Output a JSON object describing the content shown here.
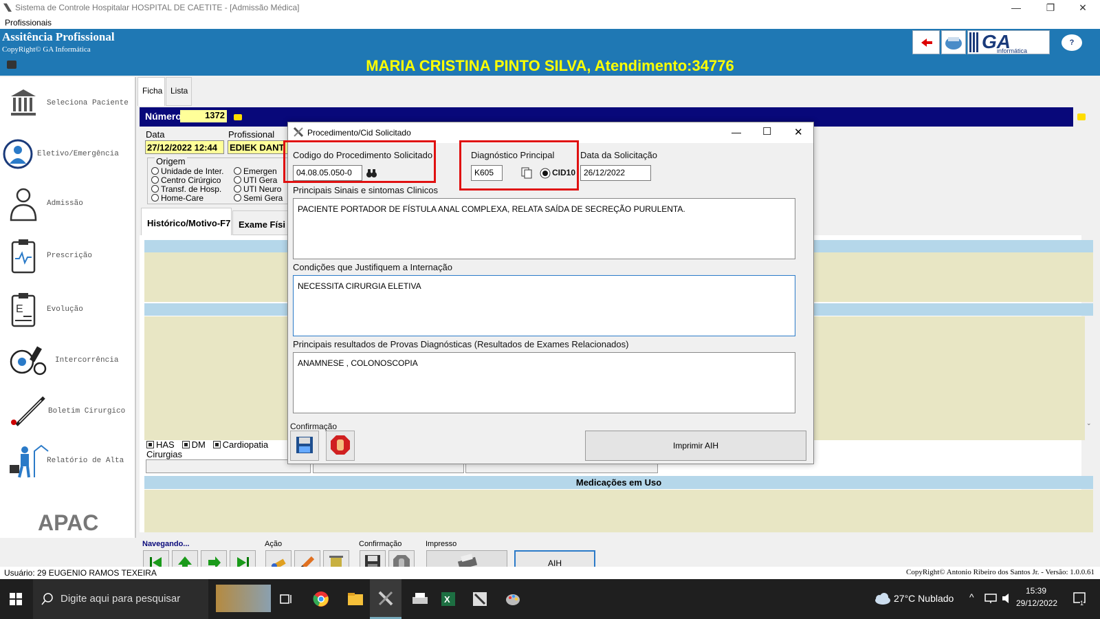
{
  "window": {
    "title": "Sistema de Controle Hospitalar HOSPITAL DE CAETITE - [Admissão Médica]",
    "menu": "Profissionais",
    "minimize": "—",
    "restore": "❐",
    "close": "✕"
  },
  "header": {
    "app_name": "Assitência Profissional",
    "copyright": "CopyRight© GA Informática",
    "logo_text": "GA",
    "logo_sub": "informática",
    "help": "?"
  },
  "patient_banner": "MARIA CRISTINA PINTO SILVA, Atendimento:34776",
  "sidebar": {
    "items": [
      {
        "label": "Seleciona Paciente",
        "icon": "bank-icon"
      },
      {
        "label": "Eletivo/Emergência",
        "icon": "doctor-badge-icon"
      },
      {
        "label": "Admissão",
        "icon": "doctor-icon"
      },
      {
        "label": "Prescrição",
        "icon": "clipboard-icon"
      },
      {
        "label": "Evolução",
        "icon": "document-icon"
      },
      {
        "label": "Intercorrência",
        "icon": "microscope-icon"
      },
      {
        "label": "Boletim Cirurgico",
        "icon": "scalpel-icon"
      },
      {
        "label": "Relatório de Alta",
        "icon": "exit-icon"
      }
    ],
    "apac": "APAC"
  },
  "tabs": {
    "ficha": "Ficha",
    "lista": "Lista"
  },
  "form": {
    "numero_label": "Número",
    "numero_value": "1372",
    "data_label": "Data",
    "data_value": "27/12/2022 12:44",
    "profissional_label": "Profissional",
    "profissional_value": "EDIEK DANT",
    "origem_label": "Origem",
    "origem_options": [
      "Unidade de Inter.",
      "Centro Cirúrgico",
      "Transf. de Hosp.",
      "Home-Care"
    ],
    "origem_options2": [
      "Emergen",
      "UTI Gera",
      "UTI Neuro",
      "Semi Gera"
    ],
    "subtab1": "Histórico/Motivo-F7",
    "subtab2": "Exame Físi",
    "checks": [
      "HAS",
      "DM",
      "Cardiopatia"
    ],
    "cirurgias_label": "Cirurgias",
    "medicacoes_label": "Medicações em Uso"
  },
  "toolbar": {
    "nav_label": "Navegando...",
    "acao_label": "Ação",
    "confirm_label": "Confirmação",
    "impresso_label": "Impresso",
    "aih_button": "AIH"
  },
  "status": {
    "user": "Usuário:  29  EUGENIO RAMOS TEXEIRA",
    "copyright": "CopyRight© Antonio Ribeiro dos Santos Jr. - Versão: 1.0.0.61"
  },
  "taskbar": {
    "search_placeholder": "Digite aqui para pesquisar",
    "weather": "27°C  Nublado",
    "time": "15:39",
    "date": "29/12/2022",
    "notifications": "1"
  },
  "dialog": {
    "title": "Procedimento/Cid Solicitado",
    "codigo_label": "Codigo do Procedimento Solicitado",
    "codigo_value": "04.08.05.050-0",
    "diag_label": "Diagnóstico Principal",
    "diag_value": "K605",
    "cid_label": "CID10",
    "data_label": "Data da Solicitação",
    "data_value": "26/12/2022",
    "sinais_label": "Principais Sinais e sintomas Clinicos",
    "sinais_value": "PACIENTE PORTADOR DE FÍSTULA ANAL COMPLEXA, RELATA SAÍDA DE SECREÇÃO PURULENTA.",
    "condicoes_label": "Condições que Justifiquem a Internação",
    "condicoes_value": "NECESSITA CIRURGIA ELETIVA",
    "resultados_label": "Principais resultados de Provas Diagnósticas (Resultados de Exames Relacionados)",
    "resultados_value": "ANAMNESE , COLONOSCOPIA",
    "confirm_label": "Confirmação",
    "imprimir_label": "Imprimir AIH"
  }
}
